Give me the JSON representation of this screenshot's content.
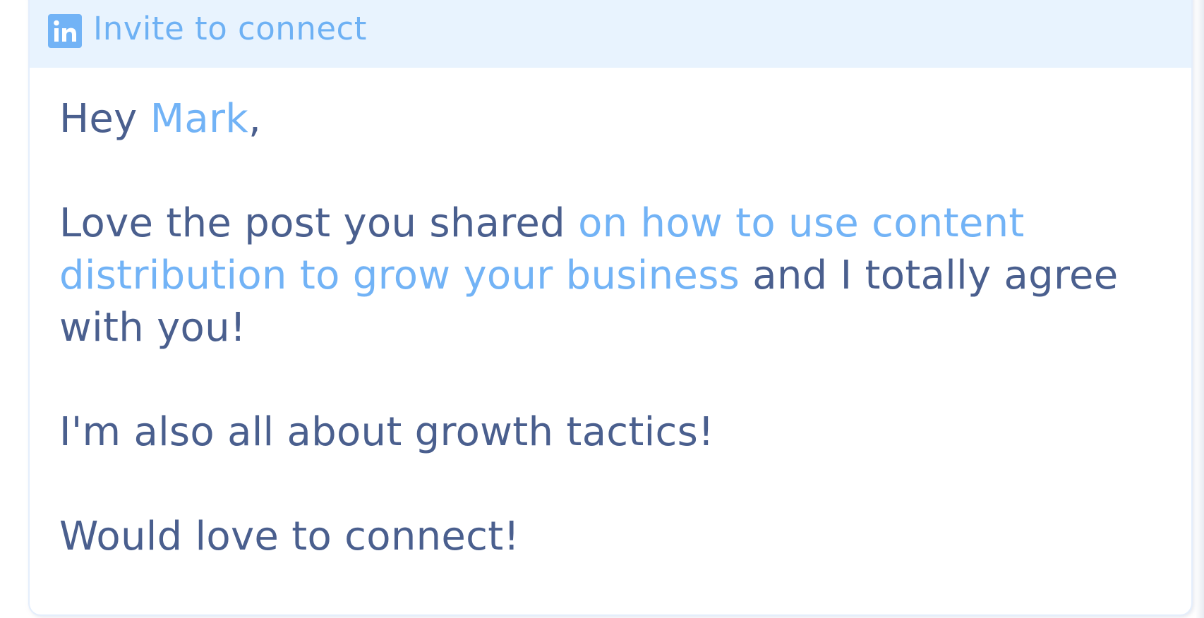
{
  "header": {
    "icon": "linkedin-icon",
    "title": "Invite to connect"
  },
  "message": {
    "greeting_prefix": "Hey ",
    "greeting_name": "Mark",
    "greeting_suffix": ",",
    "para1_start": "Love the post you shared ",
    "para1_highlight": "on how to use content distribution to grow your business",
    "para1_end": " and I totally agree with you!",
    "para2": "I'm also all about growth tactics!",
    "para3": "Would love to connect!"
  },
  "colors": {
    "accent": "#72b3f6",
    "text": "#4a5f8e",
    "header_bg": "#e8f3fe",
    "border": "#e4eefc"
  }
}
